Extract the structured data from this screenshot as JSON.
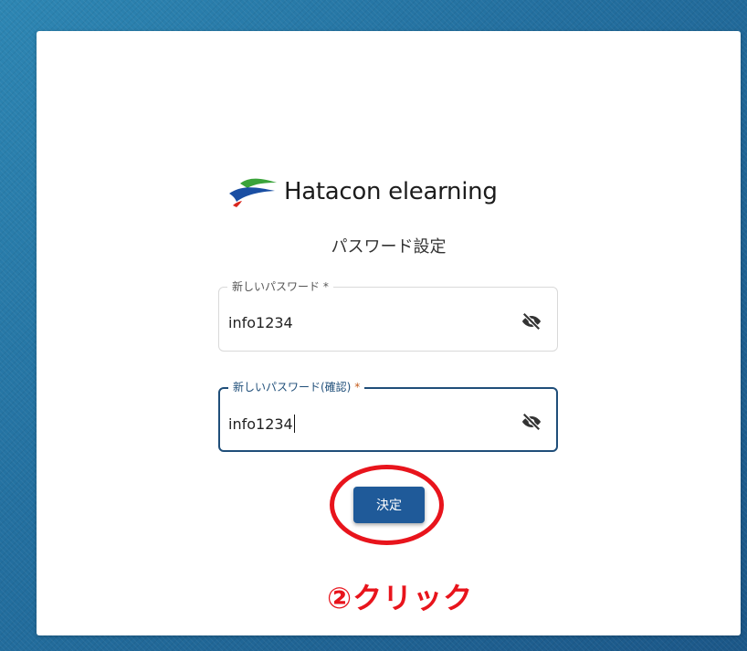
{
  "logo": {
    "text": "Hatacon elearning"
  },
  "form": {
    "title": "パスワード設定",
    "new_password": {
      "label": "新しいパスワード",
      "required_mark": "*",
      "value": "info1234"
    },
    "confirm_password": {
      "label": "新しいパスワード(確認)",
      "required_mark": "*",
      "value": "info1234"
    },
    "submit_label": "決定"
  },
  "annotation": {
    "text": "②クリック"
  },
  "colors": {
    "primary": "#1f5a99",
    "focus_border": "#1f4e79",
    "required_accent": "#c45b1a",
    "annotation_red": "#e8141c"
  },
  "icons": {
    "visibility_toggle": "eye-off-icon",
    "logo_mark": "flag-logo-icon"
  }
}
